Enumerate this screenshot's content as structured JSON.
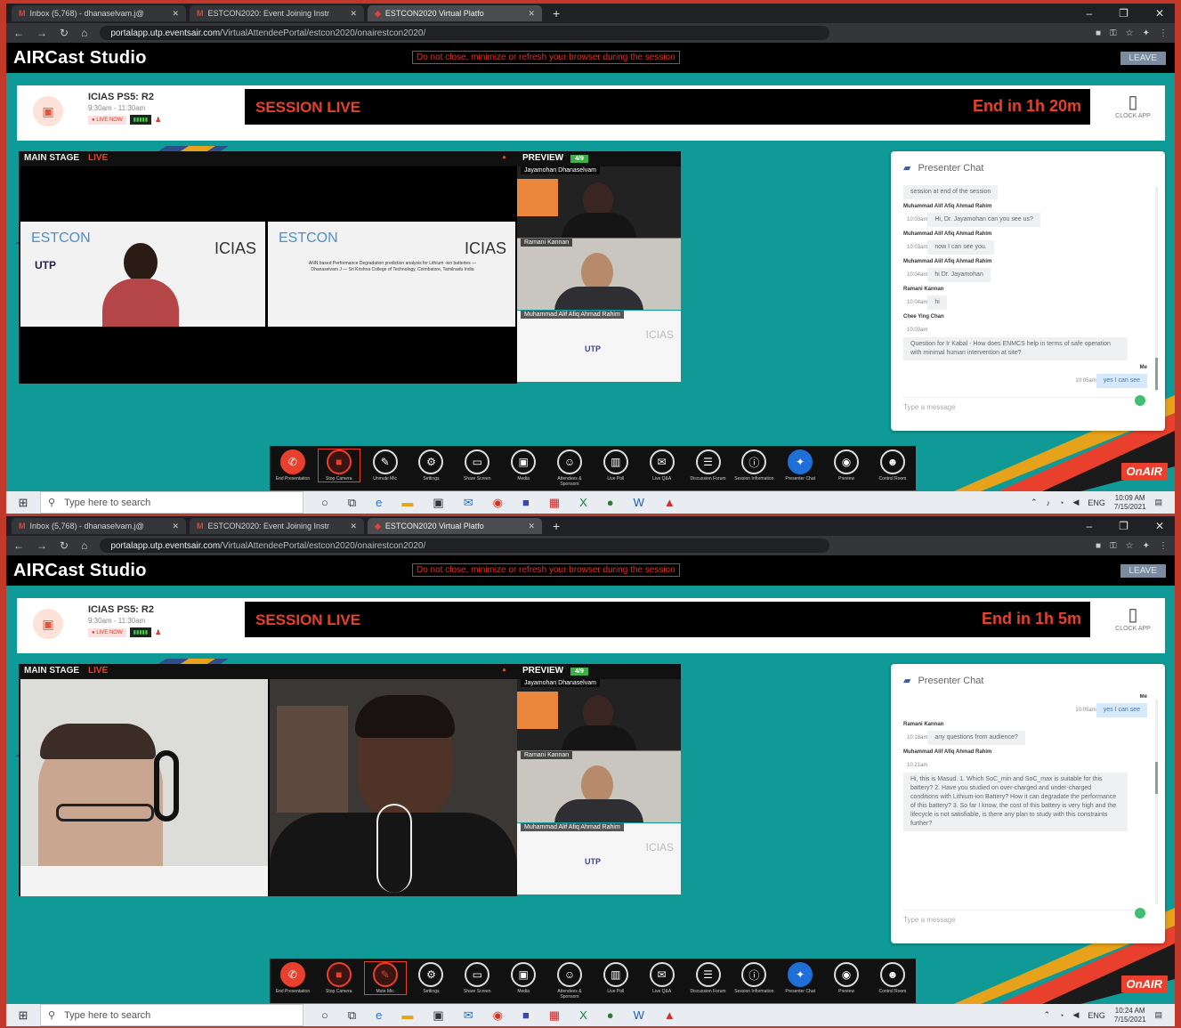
{
  "browser": {
    "tabs": [
      {
        "label": "Inbox (5,768) - dhanaselvam.j@"
      },
      {
        "label": "ESTCON2020: Event Joining Instr"
      },
      {
        "label": "ESTCON2020 Virtual Platfo"
      }
    ],
    "url_prefix": "portalapp.utp.eventsair.com",
    "url_path": "/VirtualAttendeePortal/estcon2020/onairestcon2020/"
  },
  "app": {
    "title": "AIRCast Studio",
    "warning": "Do not close, minimize or refresh your browser during the session",
    "leave_label": "LEAVE",
    "colors": {
      "accent": "#e8402c",
      "teal": "#0f9a98",
      "preview_count": "#3fae49"
    }
  },
  "session": {
    "title": "ICIAS PS5: R2",
    "time": "9:30am - 11:30am",
    "live_badge": "● LIVE NOW",
    "live_label": "SESSION LIVE",
    "clock_app": "CLOCK APP"
  },
  "screens": [
    {
      "end_label": "End in 1h 20m",
      "clock_time": "10:09 AM",
      "clock_date": "7/15/2021"
    },
    {
      "end_label": "End in 1h 5m",
      "clock_time": "10:24 AM",
      "clock_date": "7/15/2021"
    }
  ],
  "stage": {
    "main_label": "MAIN STAGE",
    "live_tag": "LIVE",
    "preview_label": "PREVIEW",
    "preview_count": "4/9",
    "slide_estcon": "ESTCON",
    "slide_icias": "ICIAS",
    "slide_uitp": "UTP",
    "slide_text": "ANN based Performance Degradation prediction analysis for Lithium -ion batteries — Dhanaselvam J — Sri Krishna College of Technology, Coimbatore, Tamilnadu India"
  },
  "preview_names": [
    "Jayamohan Dhanaselvam",
    "Ramani Kannan",
    "Muhammad Alif Afiq Ahmad Rahim"
  ],
  "chat": {
    "title": "Presenter Chat",
    "placeholder": "Type a message",
    "screen1": [
      {
        "who": "",
        "time": "",
        "text": "session at end of the session",
        "me": false
      },
      {
        "who": "Muhammad Alif Afiq Ahmad Rahim",
        "time": "10:03am",
        "text": "Hi, Dr. Jayamohan can you see us?",
        "me": false
      },
      {
        "who": "Muhammad Alif Afiq Ahmad Rahim",
        "time": "10:03am",
        "text": "now I can see you.",
        "me": false
      },
      {
        "who": "Muhammad Alif Afiq Ahmad Rahim",
        "time": "10:04am",
        "text": "hi Dr. Jayamohan",
        "me": false
      },
      {
        "who": "Ramani Kannan",
        "time": "10:04am",
        "text": "hi",
        "me": false
      },
      {
        "who": "Chee Ying Chan",
        "time": "10:03am",
        "text": "Question for Ir Kabal - How does ENMCS help in terms of safe operation with minimal human intervention at site?",
        "me": false
      },
      {
        "who": "Me",
        "time": "10:05am",
        "text": "yes I can see",
        "me": true
      }
    ],
    "screen2": [
      {
        "who": "Me",
        "time": "10:05am",
        "text": "yes I can see",
        "me": true
      },
      {
        "who": "Ramani Kannan",
        "time": "10:18am",
        "text": "any questions from audience?",
        "me": false
      },
      {
        "who": "Muhammad Alif Afiq Ahmad Rahim",
        "time": "10:21am",
        "text": "Hi, this is Masud. 1. Which SoC_min and SoC_max is suitable for this battery? 2. Have you studied on over-charged and under-charged conditions with Lithium-ion Battery? How it can degradate the performance of this battery? 3. So far I know, the cost of this battery is very high and the lifecycle is not satisfiable, is there any plan to study with this constraints further?",
        "me": false
      }
    ]
  },
  "toolbar": {
    "items1": [
      {
        "icon": "✆",
        "label": "End Presentation",
        "style": "end"
      },
      {
        "icon": "■",
        "label": "Stop Camera",
        "style": "red boxed"
      },
      {
        "icon": "✎",
        "label": "Unmute Mic",
        "style": ""
      },
      {
        "icon": "⚙",
        "label": "Settings",
        "style": ""
      },
      {
        "icon": "▭",
        "label": "Share Screen",
        "style": ""
      },
      {
        "icon": "▣",
        "label": "Media",
        "style": ""
      },
      {
        "icon": "☺",
        "label": "Attendees & Sponsors",
        "style": ""
      },
      {
        "icon": "▥",
        "label": "Live Poll",
        "style": ""
      },
      {
        "icon": "✉",
        "label": "Live Q&A",
        "style": ""
      },
      {
        "icon": "☰",
        "label": "Discussion Forum",
        "style": ""
      },
      {
        "icon": "ⓘ",
        "label": "Session Information",
        "style": ""
      },
      {
        "icon": "✦",
        "label": "Presenter Chat",
        "style": "blue"
      },
      {
        "icon": "◉",
        "label": "Preview",
        "style": ""
      },
      {
        "icon": "☻",
        "label": "Control Room",
        "style": ""
      }
    ],
    "items2": [
      {
        "icon": "✆",
        "label": "End Presentation",
        "style": "end"
      },
      {
        "icon": "■",
        "label": "Stop Camera",
        "style": "red"
      },
      {
        "icon": "✎",
        "label": "Mute Mic",
        "style": "red boxed"
      },
      {
        "icon": "⚙",
        "label": "Settings",
        "style": ""
      },
      {
        "icon": "▭",
        "label": "Share Screen",
        "style": ""
      },
      {
        "icon": "▣",
        "label": "Media",
        "style": ""
      },
      {
        "icon": "☺",
        "label": "Attendees & Sponsors",
        "style": ""
      },
      {
        "icon": "▥",
        "label": "Live Poll",
        "style": ""
      },
      {
        "icon": "✉",
        "label": "Live Q&A",
        "style": ""
      },
      {
        "icon": "☰",
        "label": "Discussion Forum",
        "style": ""
      },
      {
        "icon": "ⓘ",
        "label": "Session Information",
        "style": ""
      },
      {
        "icon": "✦",
        "label": "Presenter Chat",
        "style": "blue"
      },
      {
        "icon": "◉",
        "label": "Preview",
        "style": ""
      },
      {
        "icon": "☻",
        "label": "Control Room",
        "style": ""
      }
    ],
    "onair": "OnAIR"
  },
  "taskbar": {
    "search_placeholder": "Type here to search",
    "lang": "ENG"
  }
}
